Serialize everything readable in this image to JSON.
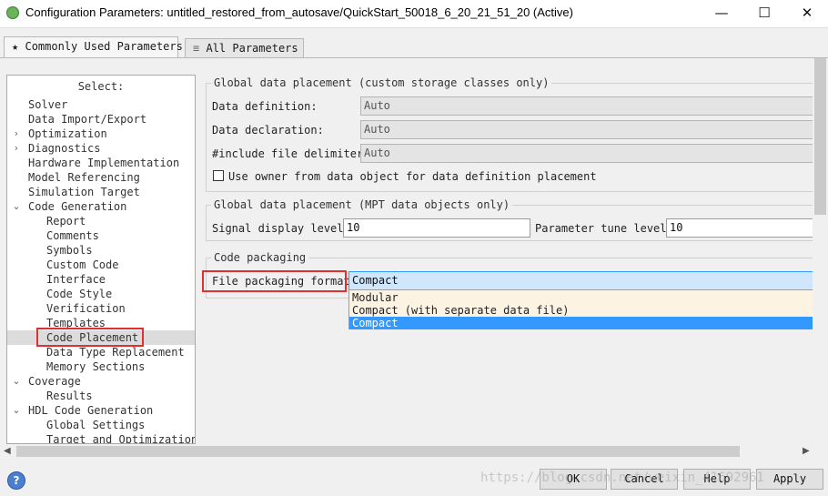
{
  "window": {
    "title": "Configuration Parameters: untitled_restored_from_autosave/QuickStart_50018_6_20_21_51_20 (Active)",
    "minimize": "—",
    "maximize": "☐",
    "close": "✕"
  },
  "tabs": [
    {
      "icon": "★",
      "label": "Commonly Used Parameters"
    },
    {
      "icon": "≡",
      "label": "All Parameters"
    }
  ],
  "tree": {
    "header": "Select:",
    "items": [
      {
        "label": "Solver"
      },
      {
        "label": "Data Import/Export"
      },
      {
        "label": "Optimization",
        "chevron": "›"
      },
      {
        "label": "Diagnostics",
        "chevron": "›"
      },
      {
        "label": "Hardware Implementation"
      },
      {
        "label": "Model Referencing"
      },
      {
        "label": "Simulation Target"
      },
      {
        "label": "Code Generation",
        "chevron": "⌄"
      },
      {
        "label": "Report"
      },
      {
        "label": "Comments"
      },
      {
        "label": "Symbols"
      },
      {
        "label": "Custom Code"
      },
      {
        "label": "Interface"
      },
      {
        "label": "Code Style"
      },
      {
        "label": "Verification"
      },
      {
        "label": "Templates"
      },
      {
        "label": "Code Placement",
        "selected": true
      },
      {
        "label": "Data Type Replacement"
      },
      {
        "label": "Memory Sections"
      },
      {
        "label": "Coverage",
        "chevron": "⌄"
      },
      {
        "label": "Results"
      },
      {
        "label": "HDL Code Generation",
        "chevron": "⌄"
      },
      {
        "label": "Global Settings"
      },
      {
        "label": "Target and Optimizations"
      }
    ]
  },
  "groups": {
    "custom": {
      "title": "Global data placement (custom storage classes only)",
      "data_definition_label": "Data definition:",
      "data_definition_value": "Auto",
      "data_declaration_label": "Data declaration:",
      "data_declaration_value": "Auto",
      "include_delim_label": "#include file delimiter:",
      "include_delim_value": "Auto",
      "owner_checkbox_label": "Use owner from data object for data definition placement"
    },
    "mpt": {
      "title": "Global data placement (MPT data objects only)",
      "signal_label": "Signal display level:",
      "signal_value": "10",
      "param_label": "Parameter tune level:",
      "param_value": "10"
    },
    "packaging": {
      "title": "Code packaging",
      "format_label": "File packaging format:",
      "format_value": "Compact",
      "options": [
        "Modular",
        "Compact (with separate data file)",
        "Compact"
      ],
      "selected_option": "Compact"
    }
  },
  "buttons": {
    "ok": "OK",
    "cancel": "Cancel",
    "help": "Help",
    "apply": "Apply"
  },
  "help_icon": "?",
  "watermark": "https://blog.csdn.net/weixin_41692961"
}
